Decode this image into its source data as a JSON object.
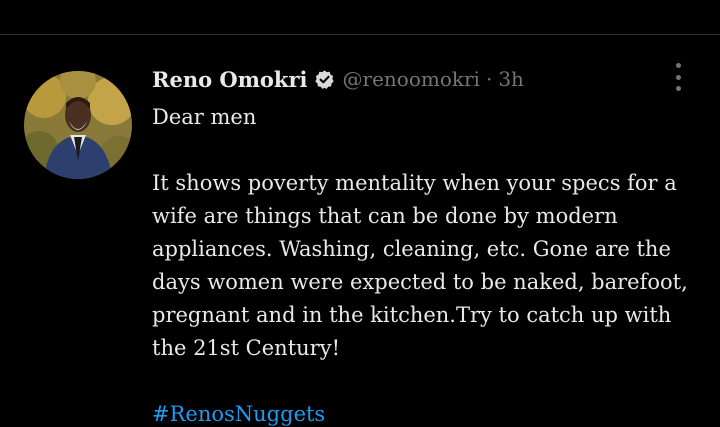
{
  "colors": {
    "background": "#000000",
    "text": "#e7e9ea",
    "muted": "#71767b",
    "link": "#1d9bf0",
    "divider": "#2f3336"
  },
  "tweet": {
    "author": {
      "display_name": "Reno Omokri",
      "verified_icon": "verified-badge-icon",
      "handle": "@renoomokri",
      "separator": "·",
      "time": "3h"
    },
    "more_icon": "more-options-icon",
    "greeting": "Dear men",
    "body_lines": [
      "It shows poverty mentality when your specs for a",
      "wife are things that can be done by modern",
      "appliances. Washing, cleaning, etc. Gone are the",
      "days women were expected to be naked, barefoot,",
      "pregnant and in the kitchen.Try to catch up with",
      "the 21st Century!"
    ],
    "hashtag": "#RenosNuggets"
  }
}
